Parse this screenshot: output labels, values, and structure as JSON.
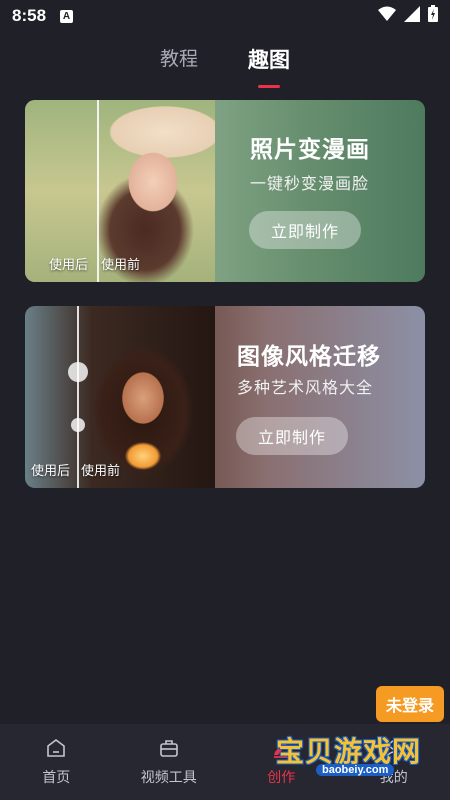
{
  "status_bar": {
    "time": "8:58",
    "notif_icon": "A"
  },
  "tabs": [
    {
      "label": "教程",
      "active": false
    },
    {
      "label": "趣图",
      "active": true
    }
  ],
  "cards": [
    {
      "title": "照片变漫画",
      "subtitle": "一键秒变漫画脸",
      "button": "立即制作",
      "after_label": "使用后",
      "before_label": "使用前"
    },
    {
      "title": "图像风格迁移",
      "subtitle": "多种艺术风格大全",
      "button": "立即制作",
      "after_label": "使用后",
      "before_label": "使用前"
    }
  ],
  "nav": [
    {
      "label": "首页",
      "icon": "home-icon",
      "active": false
    },
    {
      "label": "视频工具",
      "icon": "toolbox-icon",
      "active": false
    },
    {
      "label": "创作",
      "icon": "pen-icon",
      "active": true
    },
    {
      "label": "我的",
      "icon": "user-icon",
      "active": false
    }
  ],
  "overlay": {
    "login_badge": "未登录",
    "watermark_text": "宝贝游戏网",
    "watermark_url": "baobeiy.com"
  },
  "colors": {
    "accent": "#e8334a",
    "background": "#1f2028",
    "nav_background": "#262730",
    "badge": "#f59a23"
  }
}
